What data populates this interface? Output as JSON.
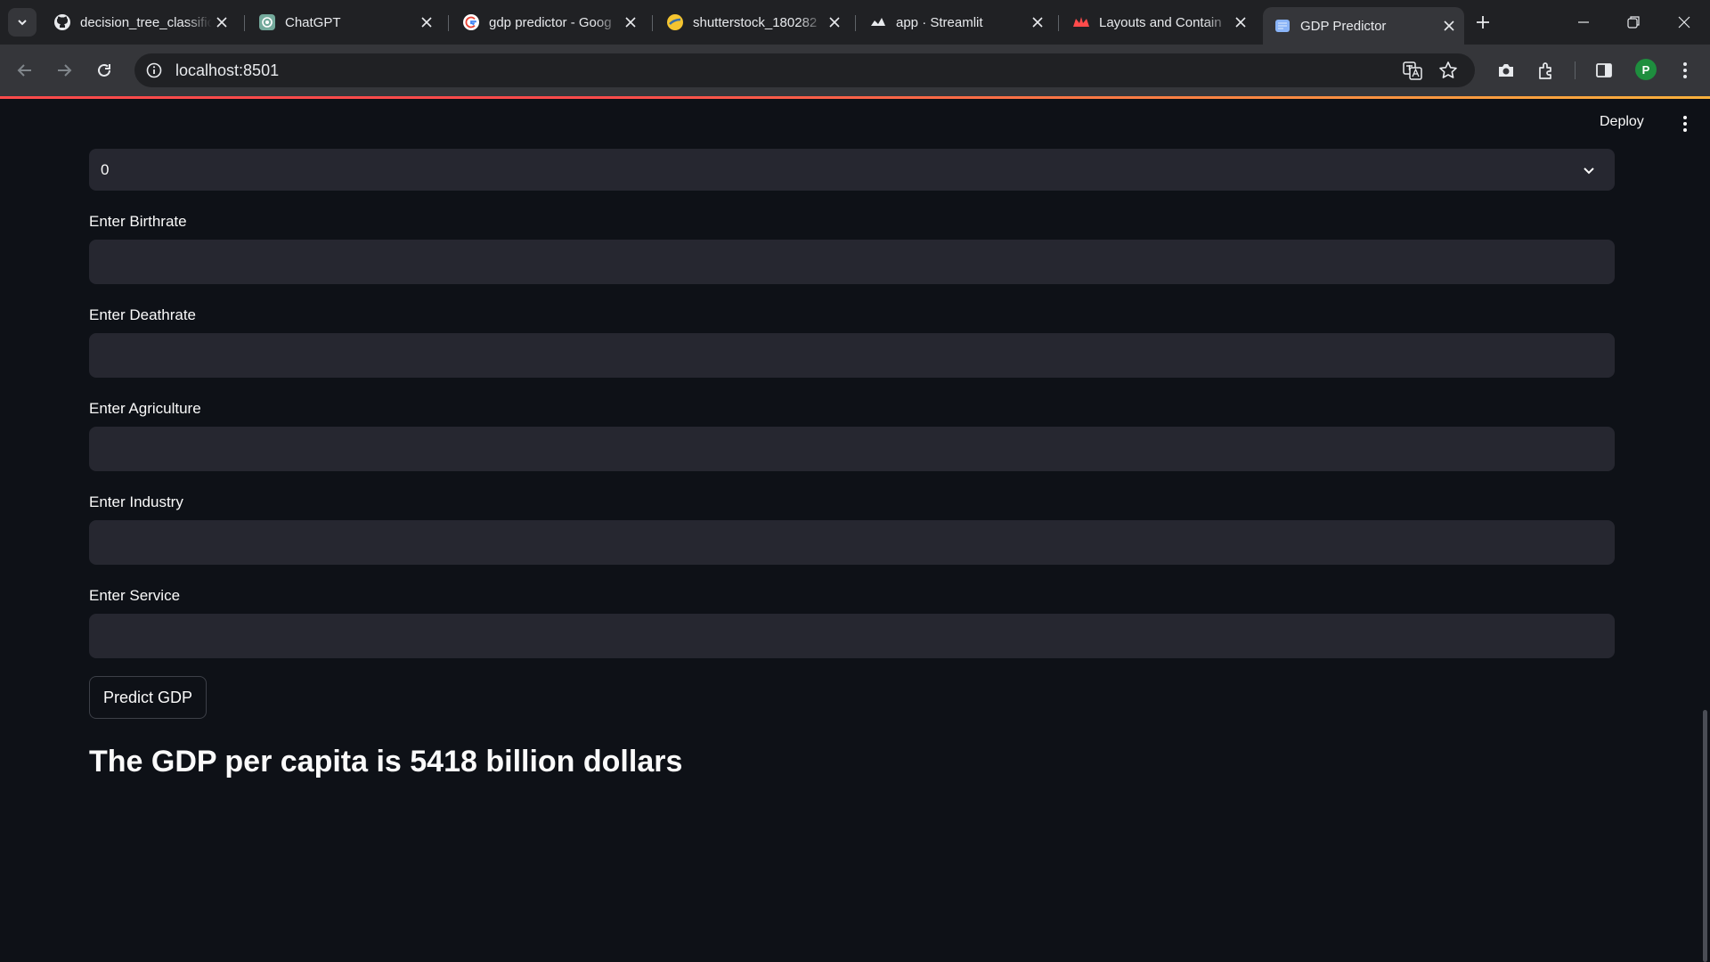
{
  "browser": {
    "tabs": [
      {
        "title": "decision_tree_classific",
        "icon": "github-icon"
      },
      {
        "title": "ChatGPT",
        "icon": "chatgpt-icon"
      },
      {
        "title": "gdp predictor - Goog",
        "icon": "google-icon"
      },
      {
        "title": "shutterstock_180282",
        "icon": "image-favicon-icon"
      },
      {
        "title": "app · Streamlit",
        "icon": "streamlit-icon"
      },
      {
        "title": "Layouts and Contain",
        "icon": "streamlit-crown-icon"
      },
      {
        "title": "GDP Predictor",
        "icon": "globe-favicon-icon",
        "active": true
      }
    ],
    "url": "localhost:8501",
    "profile_initial": "P"
  },
  "header": {
    "deploy_label": "Deploy"
  },
  "form": {
    "select_value": "0",
    "fields": [
      {
        "label": "Enter Birthrate",
        "value": ""
      },
      {
        "label": "Enter Deathrate",
        "value": ""
      },
      {
        "label": "Enter Agriculture",
        "value": ""
      },
      {
        "label": "Enter Industry",
        "value": ""
      },
      {
        "label": "Enter Service",
        "value": ""
      }
    ],
    "button_label": "Predict GDP"
  },
  "result": {
    "text": "The GDP per capita is 5418 billion dollars"
  },
  "colors": {
    "app_background": "#0e1117",
    "input_background": "#262730",
    "accent": "#ff4b4b"
  }
}
